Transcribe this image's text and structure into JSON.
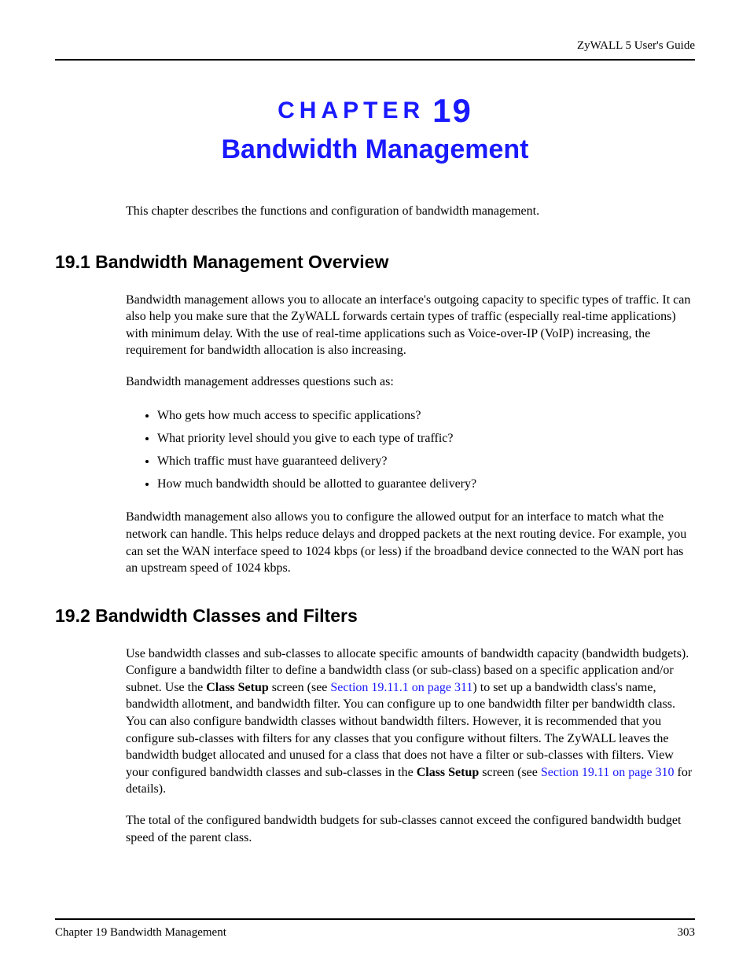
{
  "header": {
    "right": "ZyWALL 5 User's Guide"
  },
  "chapter": {
    "label_word": "CHAPTER",
    "label_num": "19",
    "title": "Bandwidth Management"
  },
  "intro": "This chapter describes the functions and configuration of bandwidth management.",
  "section1": {
    "heading": "19.1  Bandwidth Management Overview",
    "para1": "Bandwidth management allows you to allocate an interface's outgoing capacity to specific types of traffic. It can also help you make sure that the ZyWALL forwards certain types of traffic (especially real-time applications) with minimum delay. With the use of real-time applications such as Voice-over-IP (VoIP) increasing, the requirement for bandwidth allocation is also increasing.",
    "para2": "Bandwidth management addresses questions such as:",
    "bullets": [
      "Who gets how much access to specific applications?",
      "What priority level should you give to each type of traffic?",
      "Which traffic must have guaranteed delivery?",
      "How much bandwidth should be allotted to guarantee delivery?"
    ],
    "para3": "Bandwidth management also allows you to configure the allowed output for an interface to match what the network can handle. This helps reduce delays and dropped packets at the next routing device. For example, you can set the WAN interface speed to 1024 kbps (or less) if the broadband device connected to the WAN port has an upstream speed of 1024 kbps."
  },
  "section2": {
    "heading": "19.2  Bandwidth Classes and Filters",
    "para1_pre": "Use bandwidth classes and sub-classes to allocate specific amounts of bandwidth capacity (bandwidth budgets). Configure a bandwidth filter to define a bandwidth class (or sub-class) based on a specific application and/or subnet. Use the ",
    "para1_bold1": "Class Setup",
    "para1_mid1": " screen (see ",
    "para1_link1": "Section 19.11.1 on page 311",
    "para1_mid2": ") to set up a bandwidth class's name, bandwidth allotment, and bandwidth filter. You can configure up to one bandwidth filter per bandwidth class. You can also configure bandwidth classes without bandwidth filters. However, it is recommended that you configure sub-classes with filters for any classes that you configure without filters. The ZyWALL leaves the bandwidth budget allocated and unused for a class that does not have a filter or sub-classes with filters. View your configured bandwidth classes and sub-classes in the ",
    "para1_bold2": "Class Setup",
    "para1_mid3": " screen (see ",
    "para1_link2": "Section 19.11 on page 310",
    "para1_post": " for details).",
    "para2": "The total of the configured bandwidth budgets for sub-classes cannot exceed the configured bandwidth budget speed of the parent class."
  },
  "footer": {
    "left": "Chapter 19 Bandwidth Management",
    "right": "303"
  }
}
